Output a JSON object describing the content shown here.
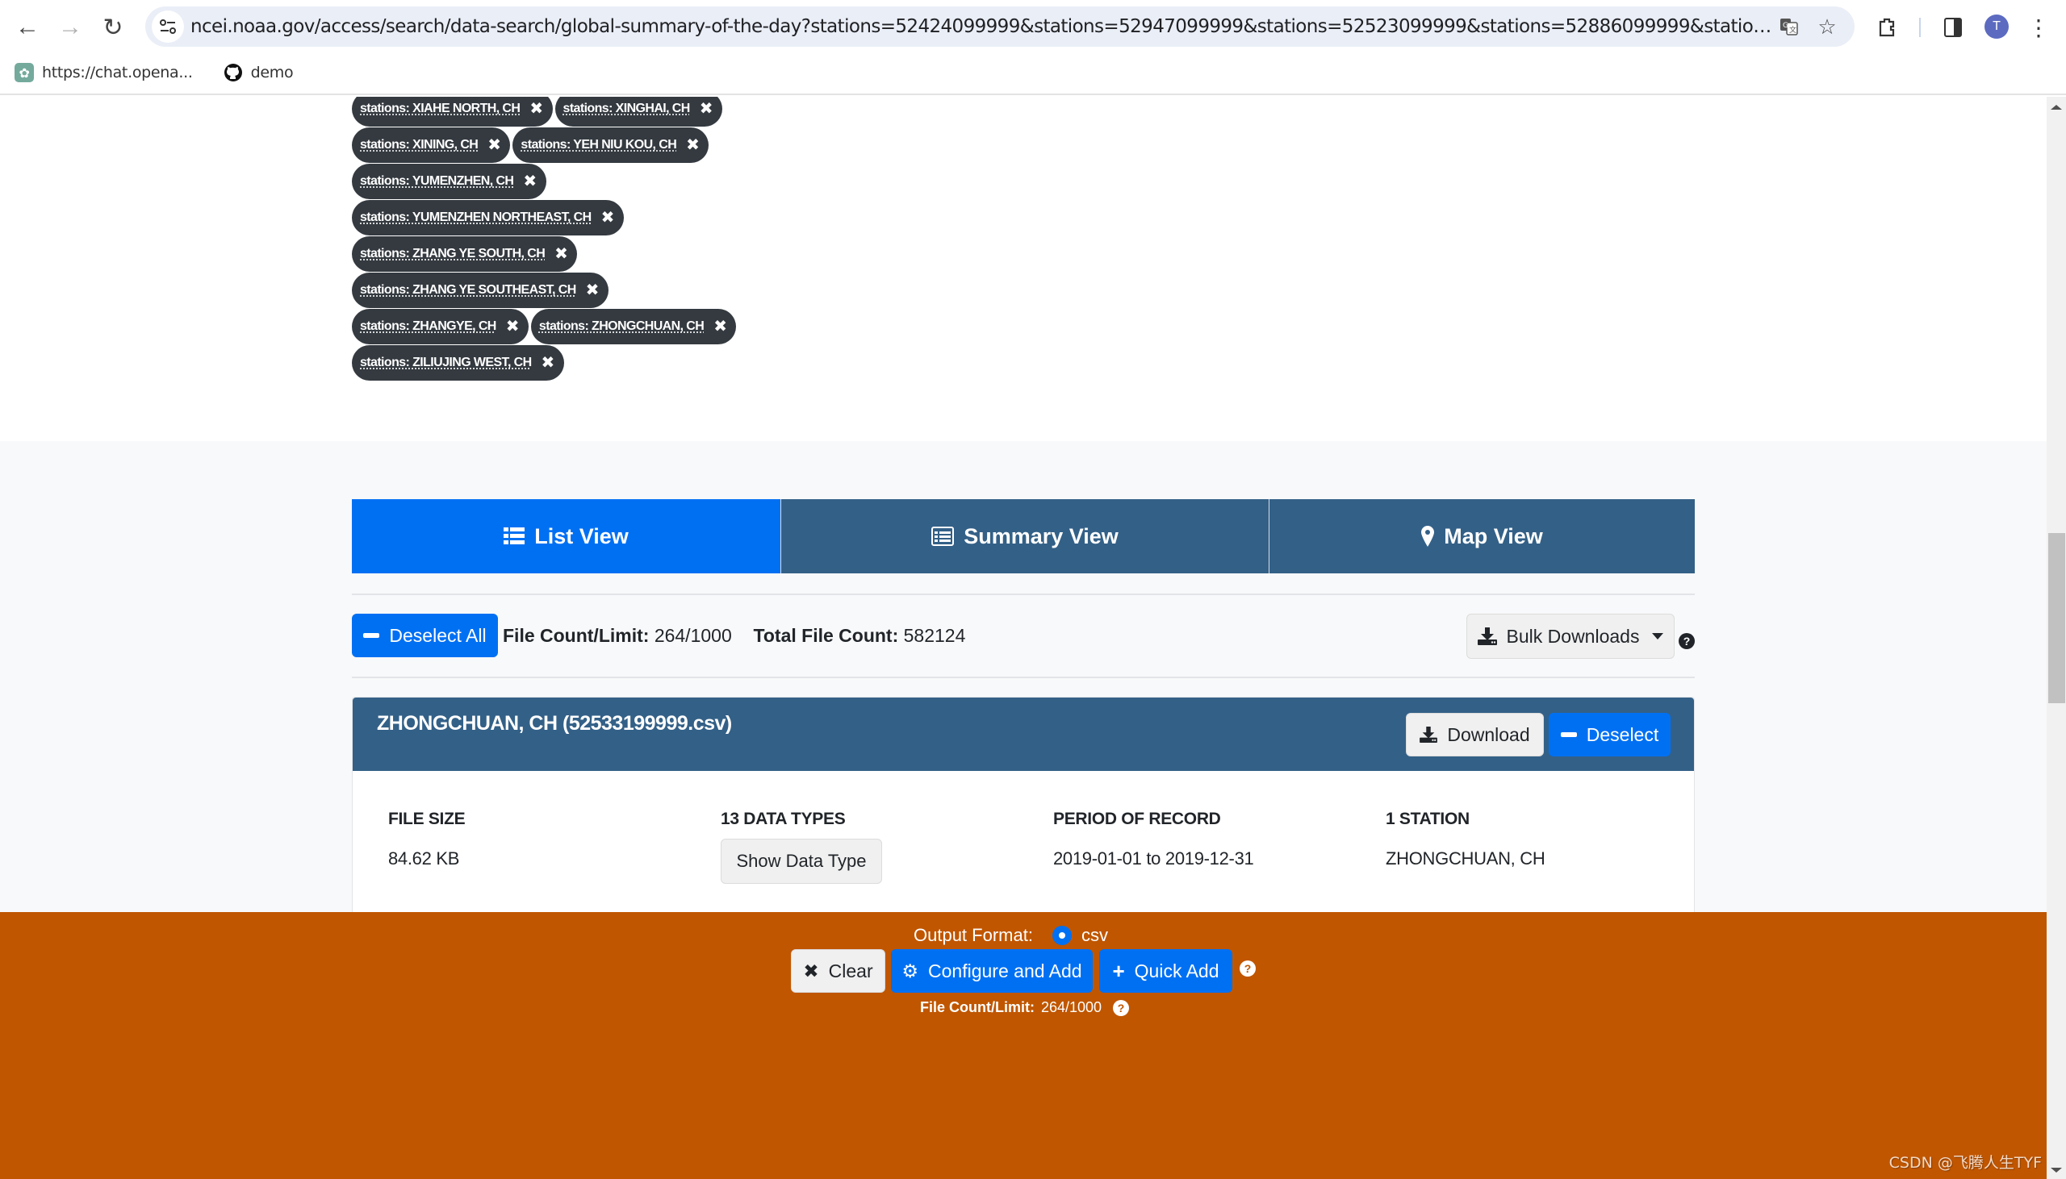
{
  "browser": {
    "url": "ncei.noaa.gov/access/search/data-search/global-summary-of-the-day?stations=52424099999&stations=52947099999&stations=52523099999&stations=52886099999&stations=52958099999...",
    "profile_initial": "T",
    "bookmarks": [
      {
        "label": "https://chat.opena...",
        "icon": "chatgpt-icon"
      },
      {
        "label": "demo",
        "icon": "github-icon"
      }
    ]
  },
  "filters": {
    "rows": [
      [
        {
          "label": "stations: XIAHE NORTH, CH"
        },
        {
          "label": "stations: XINGHAI, CH"
        }
      ],
      [
        {
          "label": "stations: XINING, CH"
        },
        {
          "label": "stations: YEH NIU KOU, CH"
        }
      ],
      [
        {
          "label": "stations: YUMENZHEN, CH"
        }
      ],
      [
        {
          "label": "stations: YUMENZHEN NORTHEAST, CH"
        }
      ],
      [
        {
          "label": "stations: ZHANG YE SOUTH, CH"
        }
      ],
      [
        {
          "label": "stations: ZHANG YE SOUTHEAST, CH"
        }
      ],
      [
        {
          "label": "stations: ZHANGYE, CH"
        },
        {
          "label": "stations: ZHONGCHUAN, CH"
        }
      ],
      [
        {
          "label": "stations: ZILIUJING WEST, CH"
        }
      ]
    ],
    "remove_glyph": "✖"
  },
  "view_tabs": [
    {
      "label": "List View",
      "icon": "list-icon",
      "active": true
    },
    {
      "label": "Summary View",
      "icon": "summary-icon",
      "active": false
    },
    {
      "label": "Map View",
      "icon": "map-marker-icon",
      "active": false
    }
  ],
  "toolbar": {
    "deselect_all_label": "Deselect All",
    "file_count_label": "File Count/Limit:",
    "file_count_value": "264/1000",
    "total_file_count_label": "Total File Count:",
    "total_file_count_value": "582124",
    "bulk_downloads_label": "Bulk Downloads",
    "help_glyph": "?"
  },
  "result": {
    "title": "ZHONGCHUAN, CH (52533199999.csv)",
    "download_label": "Download",
    "deselect_label": "Deselect",
    "file_size_label": "FILE SIZE",
    "file_size_value": "84.62 KB",
    "data_types_label": "13 DATA TYPES",
    "show_data_type_label": "Show Data Type",
    "period_label": "PERIOD OF RECORD",
    "period_value": "2019-01-01 to 2019-12-31",
    "station_count_label": "1 STATION",
    "station_value": "ZHONGCHUAN, CH"
  },
  "footer": {
    "output_format_label": "Output Format:",
    "output_format_value": "csv",
    "clear_label": "Clear",
    "configure_label": "Configure and Add",
    "quick_add_label": "Quick Add",
    "file_count_label": "File Count/Limit:",
    "file_count_value": "264/1000"
  },
  "watermark": "CSDN @飞腾人生TYF",
  "colors": {
    "primary_blue": "#0070f3",
    "header_navy": "#336087",
    "footer_orange": "#c05600",
    "tag_dark": "#343a40"
  }
}
